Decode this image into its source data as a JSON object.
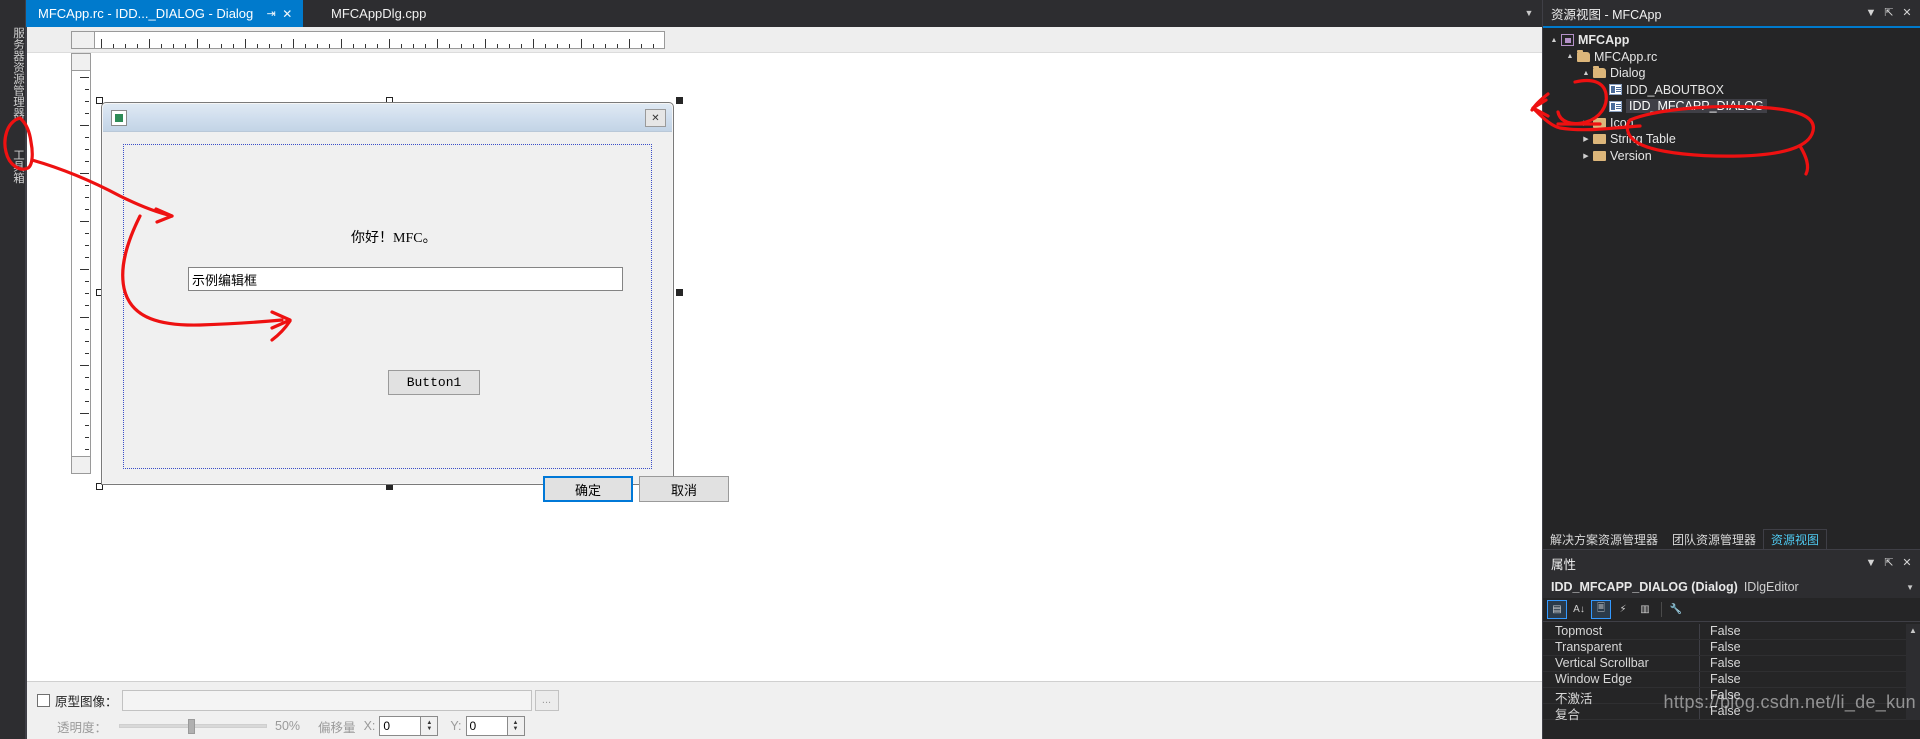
{
  "left_dock": {
    "tabs": [
      {
        "label": "服务器资源管理器",
        "name": "server-explorer"
      },
      {
        "label": "工具箱",
        "name": "toolbox"
      }
    ]
  },
  "editor_tabs": {
    "active": {
      "label": "MFCApp.rc - IDD..._DIALOG - Dialog",
      "pin": "⇥",
      "close": "✕"
    },
    "inactive": {
      "label": "MFCAppDlg.cpp"
    },
    "overflow_icon": "▼"
  },
  "design": {
    "dialog": {
      "icon_name": "app-icon",
      "close_label": "✕",
      "static_text": "你好！MFC。",
      "edit_value": "示例编辑框",
      "button1_label": "Button1",
      "ok_label": "确定",
      "cancel_label": "取消"
    }
  },
  "prototype_bar": {
    "checkbox_label": "原型图像：",
    "path_value": "",
    "browse_label": "...",
    "transparency_label": "透明度：",
    "transparency_value": "50%",
    "offset_label": "偏移量",
    "x_label": "X:",
    "x_value": "0",
    "y_label": "Y:",
    "y_value": "0"
  },
  "resource_view": {
    "title": "资源视图 - MFCApp",
    "header_buttons": {
      "dropdown": "▼",
      "pin": "⇱",
      "close": "✕"
    },
    "tree": [
      {
        "label": "MFCApp",
        "indent": 0,
        "expander": "▲",
        "icon": "project-icon",
        "bold": true,
        "selected": false
      },
      {
        "label": "MFCApp.rc",
        "indent": 1,
        "expander": "▲",
        "icon": "folder-open-icon",
        "bold": false,
        "selected": false
      },
      {
        "label": "Dialog",
        "indent": 2,
        "expander": "▲",
        "icon": "folder-open-icon",
        "bold": false,
        "selected": false
      },
      {
        "label": "IDD_ABOUTBOX",
        "indent": 3,
        "expander": "",
        "icon": "resource-icon",
        "bold": false,
        "selected": false
      },
      {
        "label": "IDD_MFCAPP_DIALOG",
        "indent": 3,
        "expander": "",
        "icon": "resource-icon",
        "bold": false,
        "selected": true
      },
      {
        "label": "Icon",
        "indent": 2,
        "expander": "▶",
        "icon": "folder-icon",
        "bold": false,
        "selected": false
      },
      {
        "label": "String Table",
        "indent": 2,
        "expander": "▶",
        "icon": "folder-icon",
        "bold": false,
        "selected": false
      },
      {
        "label": "Version",
        "indent": 2,
        "expander": "▶",
        "icon": "folder-icon",
        "bold": false,
        "selected": false
      }
    ]
  },
  "dock_tabs": [
    {
      "label": "解决方案资源管理器",
      "active": false
    },
    {
      "label": "团队资源管理器",
      "active": false
    },
    {
      "label": "资源视图",
      "active": true
    }
  ],
  "properties": {
    "title": "属性",
    "header_buttons": {
      "dropdown": "▼",
      "pin": "⇱",
      "close": "✕"
    },
    "object_name": "IDD_MFCAPP_DIALOG (Dialog)",
    "object_editor": "IDlgEditor",
    "object_caret": "▼",
    "toolbar": [
      {
        "name": "categorized-icon",
        "glyph": "▤",
        "active": true
      },
      {
        "name": "alphabetical-sort-icon",
        "glyph": "A↓",
        "active": false
      },
      {
        "name": "properties-page-icon",
        "glyph": "🗏",
        "active": true
      },
      {
        "name": "events-lightning-icon",
        "glyph": "⚡",
        "active": false
      },
      {
        "name": "messages-icon",
        "glyph": "▥",
        "active": false
      },
      {
        "name": "overrides-wrench-icon",
        "glyph": "🔧",
        "active": false
      }
    ],
    "rows": [
      {
        "key": "Topmost",
        "value": "False"
      },
      {
        "key": "Transparent",
        "value": "False"
      },
      {
        "key": "Vertical Scrollbar",
        "value": "False"
      },
      {
        "key": "Window Edge",
        "value": "False"
      },
      {
        "key": "不激活",
        "value": "False"
      },
      {
        "key": "复合",
        "value": "False"
      }
    ],
    "scroll_up_icon": "▲"
  },
  "watermark": "https://blog.csdn.net/li_de_kun",
  "colors": {
    "accent": "#007acc",
    "chrome_dark": "#2d2d30",
    "panel_dark": "#252526",
    "annotation_red": "#ee1111",
    "tab_active_text": "#4ec9f0"
  }
}
